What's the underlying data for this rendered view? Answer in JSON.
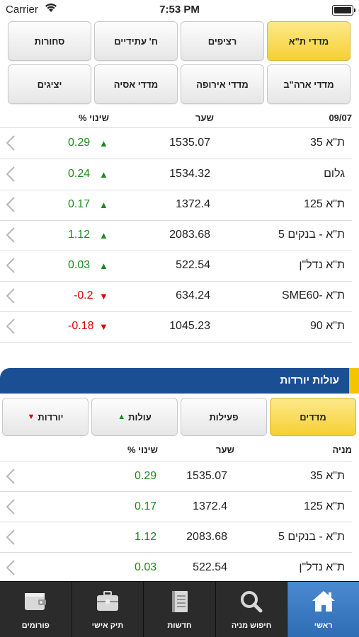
{
  "status": {
    "carrier": "Carrier",
    "time": "7:53 PM"
  },
  "panel1": {
    "buttons_row1": [
      "מדדי ת\"א",
      "רציפים",
      "ח' עתידיים",
      "סחורות"
    ],
    "buttons_row2": [
      "מדדי ארה\"ב",
      "מדדי אירופה",
      "מדדי אסיה",
      "יציגים"
    ],
    "header": {
      "date": "09/07",
      "rate": "שער",
      "change": "שינוי %"
    },
    "rows": [
      {
        "name": "ת\"א 35",
        "rate": "1535.07",
        "change": "0.29",
        "dir": "up"
      },
      {
        "name": "גלום",
        "rate": "1534.32",
        "change": "0.24",
        "dir": "up"
      },
      {
        "name": "ת\"א 125",
        "rate": "1372.4",
        "change": "0.17",
        "dir": "up"
      },
      {
        "name": "ת\"א - בנקים 5",
        "rate": "2083.68",
        "change": "1.12",
        "dir": "up"
      },
      {
        "name": "ת\"א נדל\"ן",
        "rate": "522.54",
        "change": "0.03",
        "dir": "up"
      },
      {
        "name": "ת\"א -SME60",
        "rate": "634.24",
        "change": "-0.2",
        "dir": "down"
      },
      {
        "name": "ת\"א 90",
        "rate": "1045.23",
        "change": "-0.18",
        "dir": "down"
      }
    ]
  },
  "section2": {
    "title": "עולות יורדות",
    "buttons": [
      "מדדים",
      "פעילות",
      "עולות",
      "יורדות"
    ],
    "header": {
      "name": "מניה",
      "rate": "שער",
      "change": "שינוי %"
    },
    "rows": [
      {
        "name": "ת\"א 35",
        "rate": "1535.07",
        "change": "0.29"
      },
      {
        "name": "ת\"א 125",
        "rate": "1372.4",
        "change": "0.17"
      },
      {
        "name": "ת\"א - בנקים 5",
        "rate": "2083.68",
        "change": "1.12"
      },
      {
        "name": "ת\"א נדל\"ן",
        "rate": "522.54",
        "change": "0.03"
      }
    ]
  },
  "tabbar": [
    {
      "label": "ראשי",
      "icon": "home-icon"
    },
    {
      "label": "חיפוש מניה",
      "icon": "search-icon"
    },
    {
      "label": "חדשות",
      "icon": "news-icon"
    },
    {
      "label": "תיק אישי",
      "icon": "briefcase-icon"
    },
    {
      "label": "פורומים",
      "icon": "wallet-icon"
    }
  ],
  "colors": {
    "accent_yellow": "#f5d034",
    "header_blue": "#1b4f93",
    "positive": "#1a8a1a",
    "negative": "#e00000"
  }
}
